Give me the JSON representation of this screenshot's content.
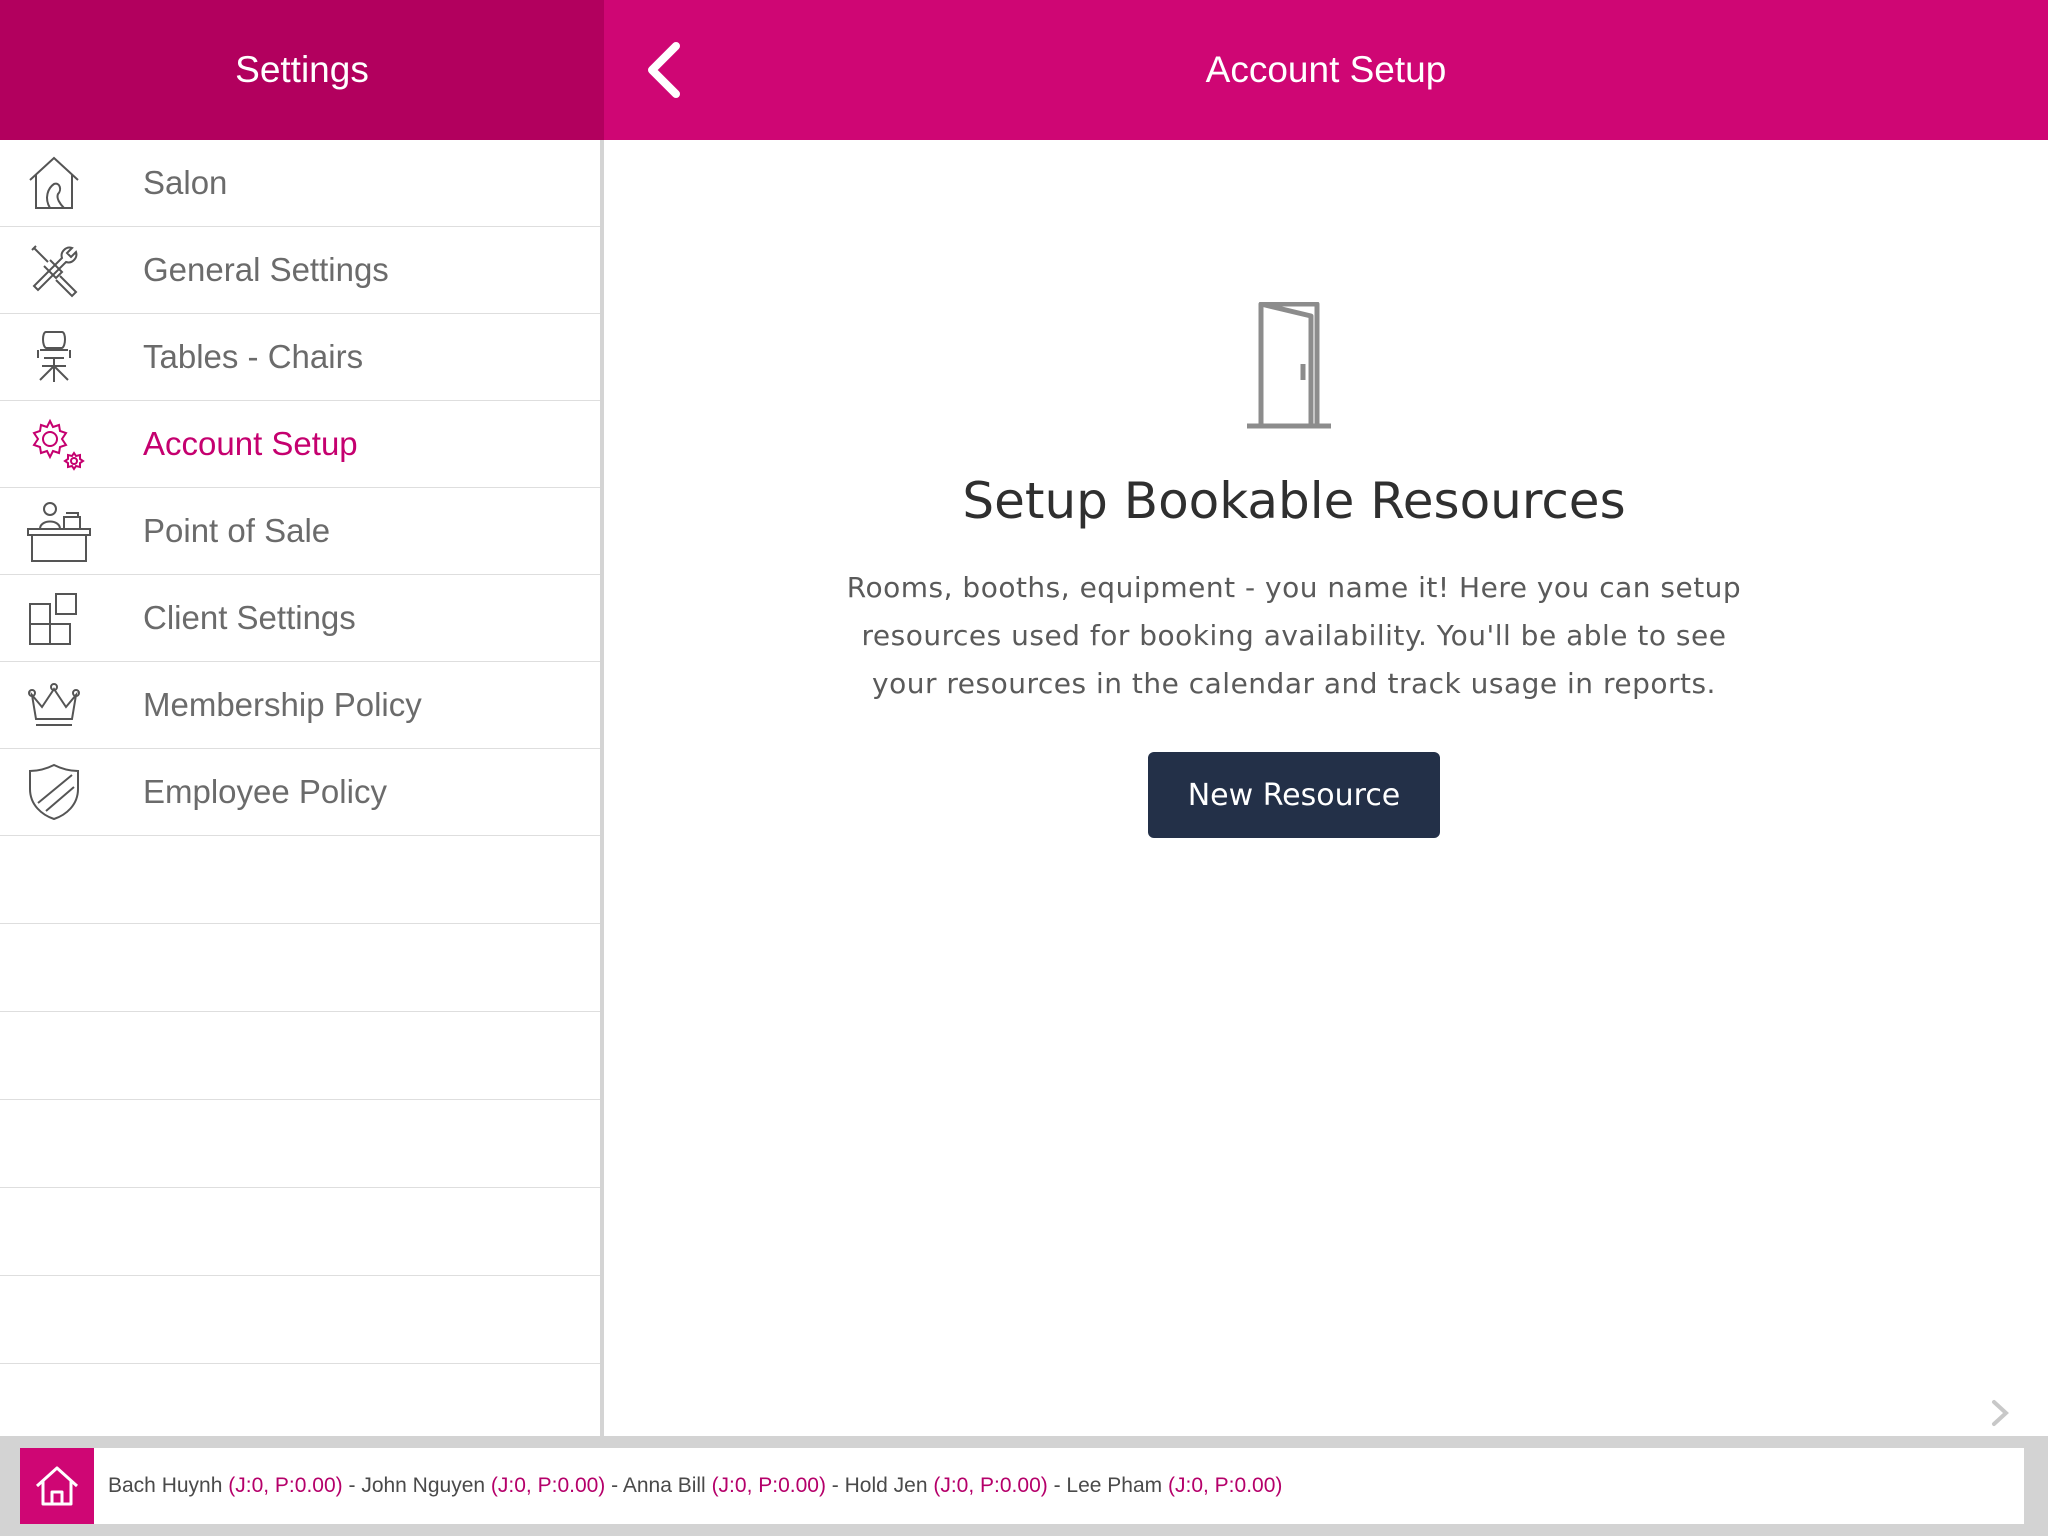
{
  "sidebar": {
    "title": "Settings",
    "items": [
      {
        "label": "Salon",
        "icon": "salon-house-icon",
        "active": false
      },
      {
        "label": "General Settings",
        "icon": "tools-icon",
        "active": false
      },
      {
        "label": "Tables - Chairs",
        "icon": "chair-icon",
        "active": false
      },
      {
        "label": "Account Setup",
        "icon": "gears-icon",
        "active": true
      },
      {
        "label": "Point of Sale",
        "icon": "cashier-icon",
        "active": false
      },
      {
        "label": "Client Settings",
        "icon": "tiles-icon",
        "active": false
      },
      {
        "label": "Membership Policy",
        "icon": "crown-icon",
        "active": false
      },
      {
        "label": "Employee Policy",
        "icon": "shield-icon",
        "active": false
      }
    ]
  },
  "header": {
    "title": "Account Setup",
    "back_icon": "chevron-left-icon"
  },
  "main": {
    "empty_state": {
      "icon": "door-icon",
      "title": "Setup Bookable Resources",
      "description": "Rooms, booths, equipment - you name it! Here you can setup resources used for booking availability. You'll be able to see your resources in the calendar and track usage in reports.",
      "button_label": "New Resource"
    }
  },
  "bottom_bar": {
    "home_icon": "home-icon",
    "staff": [
      {
        "name": "Bach Huynh",
        "stats": "(J:0, P:0.00)"
      },
      {
        "name": "John Nguyen",
        "stats": "(J:0, P:0.00)"
      },
      {
        "name": "Anna Bill",
        "stats": "(J:0, P:0.00)"
      },
      {
        "name": "Hold Jen",
        "stats": "(J:0, P:0.00)"
      },
      {
        "name": "Lee Pham",
        "stats": "(J:0, P:0.00)"
      }
    ],
    "separator": " - "
  },
  "colors": {
    "sidebar_header": "#b2005e",
    "main_header": "#cf0674",
    "accent": "#c5006f",
    "button": "#233048"
  }
}
